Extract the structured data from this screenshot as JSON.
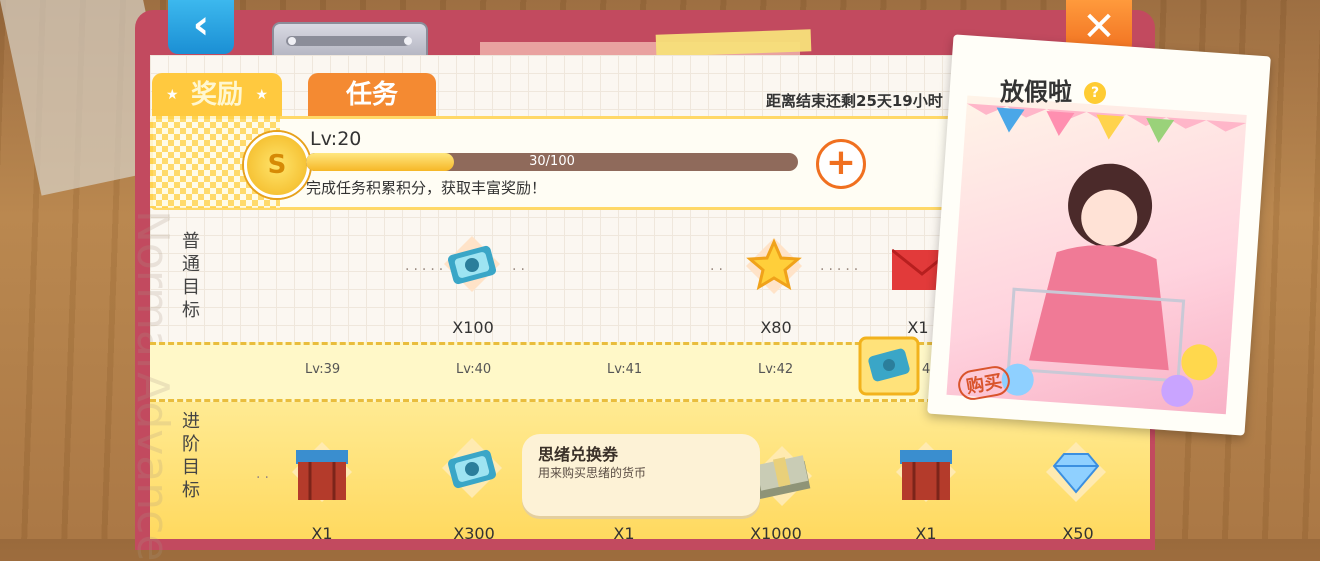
{
  "header": {
    "back_glyph": "‹",
    "close_glyph": "✕"
  },
  "tabs": [
    {
      "label": "奖励",
      "selected": true
    },
    {
      "label": "任务",
      "selected": false
    }
  ],
  "countdown": "距离结束还剩25天19小时",
  "level_panel": {
    "coin_letter": "S",
    "level": "Lv:20",
    "progress_text": "30/100",
    "progress_value": 0.3,
    "description": "完成任务积累积分，获取丰富奖励！",
    "plus": "+"
  },
  "rows": {
    "normal": {
      "label": "普通目标",
      "watermark": "Normal"
    },
    "advanced": {
      "label": "进阶目标",
      "watermark": "Advance"
    }
  },
  "levels": [
    "Lv:39",
    "Lv:40",
    "Lv:41",
    "Lv:42",
    "43"
  ],
  "normal_rewards": [
    {
      "icon": "ticket-icon",
      "qty": "X100"
    },
    {
      "icon": "star-icon",
      "qty": "X80"
    },
    {
      "icon": "red-envelope-icon",
      "qty": "X1"
    }
  ],
  "advanced_rewards": [
    {
      "icon": "crate-icon",
      "qty": "X1"
    },
    {
      "icon": "ticket-icon",
      "qty": "X300"
    },
    {
      "icon": "",
      "qty": "X1"
    },
    {
      "icon": "cash-stack-icon",
      "qty": "X1000"
    },
    {
      "icon": "crate-icon",
      "qty": "X1"
    },
    {
      "icon": "diamond-icon",
      "qty": "X50"
    }
  ],
  "tooltip": {
    "title": "思绪兑换券",
    "description": "用来购买思绪的货币"
  },
  "card": {
    "title": "放假啦",
    "help": "?",
    "stamp": "购买"
  },
  "colors": {
    "tab_active": "#f48a32",
    "tab_reward": "#ffc93f",
    "accent_orange": "#f07020",
    "back_blue": "#1b8fd4",
    "folder_red": "#c24a5f"
  }
}
